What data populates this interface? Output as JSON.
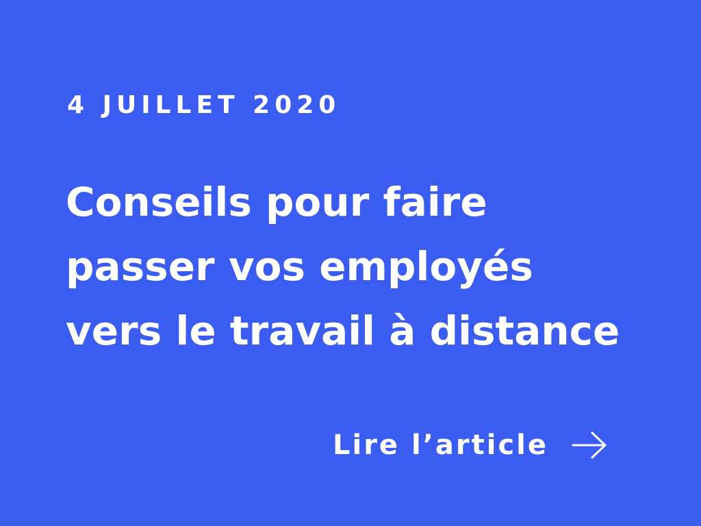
{
  "article": {
    "date": "4 JUILLET 2020",
    "title_lines": [
      "Conseils pour faire",
      "passer vos employés",
      "vers le travail à distance"
    ],
    "cta_label": "Lire l’article",
    "cta_icon": "arrow-right-icon"
  },
  "colors": {
    "background": "#3a5cf0",
    "text": "#ffffff"
  }
}
